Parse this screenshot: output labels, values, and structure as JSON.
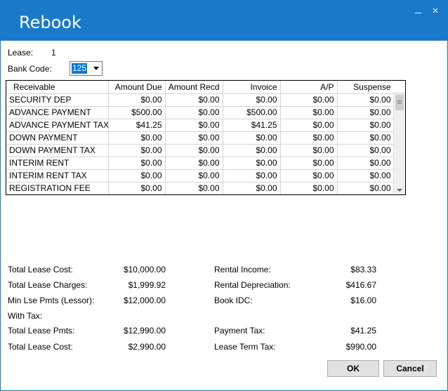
{
  "window": {
    "title": "Rebook",
    "minimize_glyph": "",
    "close_glyph": "×"
  },
  "lease": {
    "label": "Lease:",
    "value": "1"
  },
  "bank_code": {
    "label": "Bank Code:",
    "value": "125"
  },
  "grid": {
    "columns": [
      "Receivable",
      "Amount Due",
      "Amount Recd",
      "Invoice",
      "A/P",
      "Suspense"
    ],
    "rows": [
      [
        "SECURITY DEP",
        "$0.00",
        "$0.00",
        "$0.00",
        "$0.00",
        "$0.00"
      ],
      [
        "ADVANCE PAYMENT",
        "$500.00",
        "$0.00",
        "$500.00",
        "$0.00",
        "$0.00"
      ],
      [
        "ADVANCE PAYMENT TAX",
        "$41.25",
        "$0.00",
        "$41.25",
        "$0.00",
        "$0.00"
      ],
      [
        "DOWN PAYMENT",
        "$0.00",
        "$0.00",
        "$0.00",
        "$0.00",
        "$0.00"
      ],
      [
        "DOWN PAYMENT TAX",
        "$0.00",
        "$0.00",
        "$0.00",
        "$0.00",
        "$0.00"
      ],
      [
        "INTERIM RENT",
        "$0.00",
        "$0.00",
        "$0.00",
        "$0.00",
        "$0.00"
      ],
      [
        "INTERIM RENT TAX",
        "$0.00",
        "$0.00",
        "$0.00",
        "$0.00",
        "$0.00"
      ],
      [
        "REGISTRATION FEE",
        "$0.00",
        "$0.00",
        "$0.00",
        "$0.00",
        "$0.00"
      ]
    ]
  },
  "totals": {
    "total_lease_cost": {
      "label": "Total Lease Cost:",
      "value": "$10,000.00"
    },
    "total_lease_charges": {
      "label": "Total Lease Charges:",
      "value": "$1,999.92"
    },
    "min_lse_pmts": {
      "label": "Min Lse Pmts (Lessor):",
      "value": "$12,000.00"
    },
    "with_tax_label": "With Tax:",
    "total_lease_pmts": {
      "label": "Total Lease Pmts:",
      "value": "$12,990.00"
    },
    "total_lease_cost_tax": {
      "label": "Total Lease Cost:",
      "value": "$2,990.00"
    },
    "rental_income": {
      "label": "Rental Income:",
      "value": "$83.33"
    },
    "rental_depreciation": {
      "label": "Rental Depreciation:",
      "value": "$416.67"
    },
    "book_idc": {
      "label": "Book IDC:",
      "value": "$16.00"
    },
    "payment_tax": {
      "label": "Payment Tax:",
      "value": "$41.25"
    },
    "lease_term_tax": {
      "label": "Lease Term Tax:",
      "value": "$990.00"
    }
  },
  "buttons": {
    "ok": "OK",
    "cancel": "Cancel"
  },
  "colors": {
    "titlebar": "#1979ca",
    "selection": "#0078d7"
  }
}
